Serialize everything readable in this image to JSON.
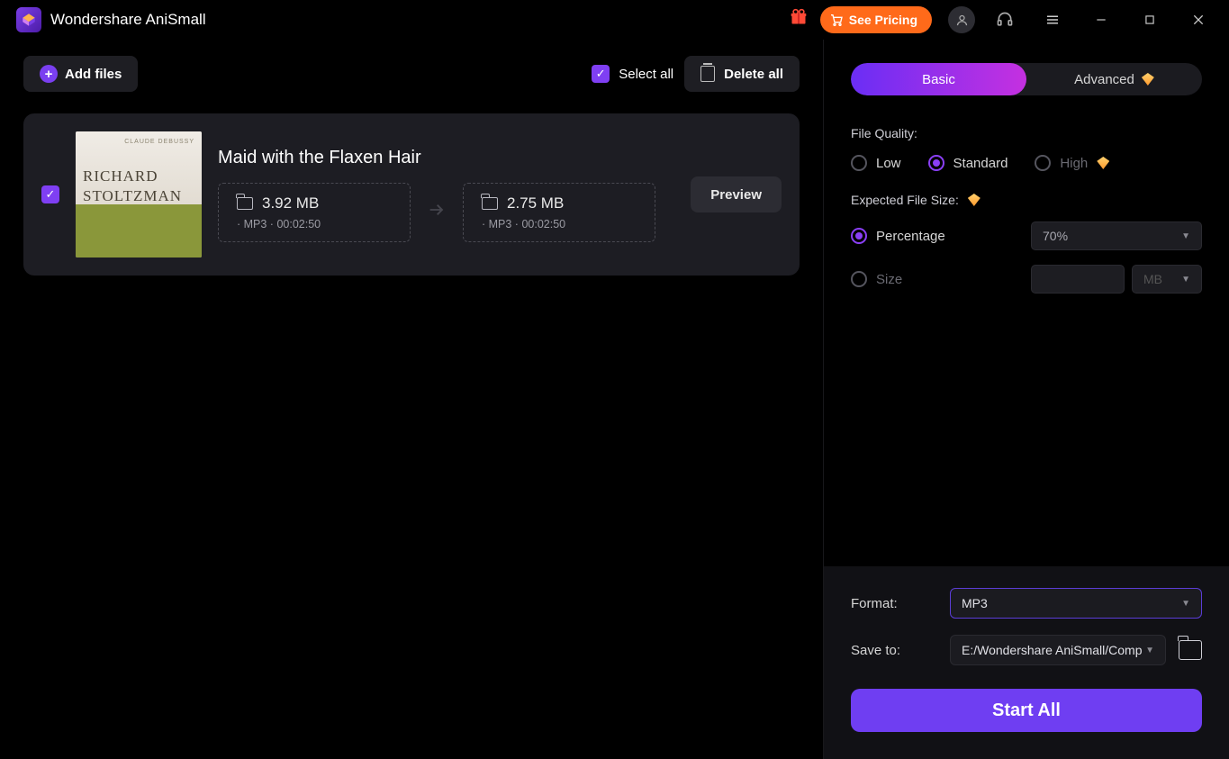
{
  "titlebar": {
    "app_name": "Wondershare AniSmall",
    "see_pricing": "See Pricing"
  },
  "toolbar": {
    "add_files": "Add files",
    "select_all": "Select all",
    "delete_all": "Delete all"
  },
  "file": {
    "title": "Maid with the Flaxen Hair",
    "thumb_line1": "RICHARD",
    "thumb_line2": "STOLTZMAN",
    "thumb_small": "CLAUDE DEBUSSY",
    "from_size": "3.92 MB",
    "from_meta": "· MP3  · 00:02:50",
    "to_size": "2.75 MB",
    "to_meta": "· MP3  · 00:02:50",
    "preview": "Preview"
  },
  "settings": {
    "tab_basic": "Basic",
    "tab_advanced": "Advanced",
    "file_quality_label": "File Quality:",
    "q_low": "Low",
    "q_standard": "Standard",
    "q_high": "High",
    "expected_label": "Expected File Size:",
    "opt_percentage": "Percentage",
    "percentage_value": "70%",
    "opt_size": "Size",
    "size_unit": "MB"
  },
  "bottom": {
    "format_label": "Format:",
    "format_value": "MP3",
    "save_label": "Save to:",
    "save_value": "E:/Wondershare AniSmall/Comp",
    "start_all": "Start All"
  }
}
